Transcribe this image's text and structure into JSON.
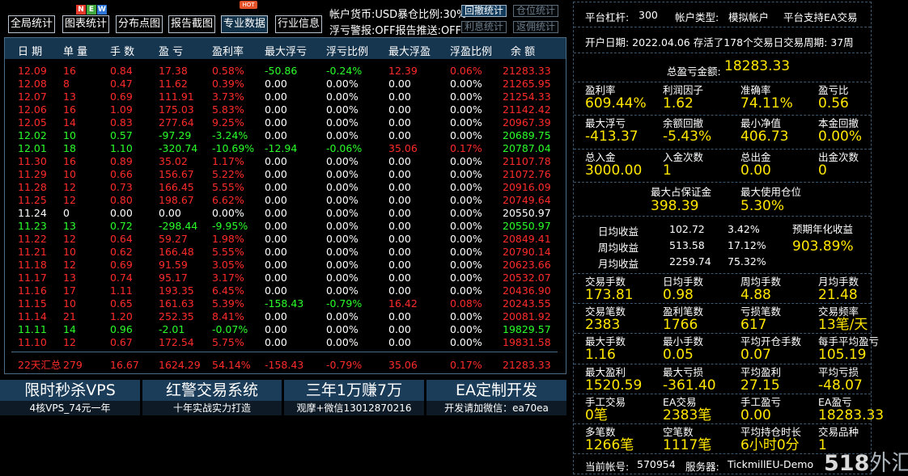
{
  "toolbar": {
    "buttons": [
      "全局统计",
      "图表统计",
      "分布点图",
      "报告截图",
      "专业数据",
      "行业信息"
    ],
    "new_badge": [
      "N",
      "E",
      "W"
    ],
    "hot_badge": "HOT"
  },
  "settings": {
    "line1": "帐户货币:USD暴仓比例:30%",
    "line2": "浮亏警报:OFF报告推送:OFF",
    "btn_drawdown": "回撤统计",
    "btn_position": "仓位统计",
    "btn_interest": "利息统计",
    "btn_rebate": "返佣统计"
  },
  "table": {
    "headers": [
      "日 期",
      "单 量",
      "手 数",
      "盈 亏",
      "盈利率",
      "最大浮亏",
      "浮亏比例",
      "最大浮盈",
      "浮盈比例",
      "余 额"
    ],
    "rows": [
      [
        "12.09",
        "16",
        "0.84",
        "17.38",
        "0.58%",
        "-50.86",
        "-0.24%",
        "12.39",
        "0.06%",
        "21283.33"
      ],
      [
        "12.08",
        "8",
        "0.47",
        "11.62",
        "0.39%",
        "0.00",
        "0.00%",
        "0.00",
        "0.00%",
        "21265.95"
      ],
      [
        "12.07",
        "13",
        "0.69",
        "111.91",
        "3.73%",
        "0.00",
        "0.00%",
        "0.00",
        "0.00%",
        "21254.33"
      ],
      [
        "12.06",
        "16",
        "1.09",
        "175.03",
        "5.83%",
        "0.00",
        "0.00%",
        "0.00",
        "0.00%",
        "21142.42"
      ],
      [
        "12.05",
        "14",
        "0.83",
        "277.64",
        "9.25%",
        "0.00",
        "0.00%",
        "0.00",
        "0.00%",
        "20967.39"
      ],
      [
        "12.02",
        "10",
        "0.57",
        "-97.29",
        "-3.24%",
        "0.00",
        "0.00%",
        "0.00",
        "0.00%",
        "20689.75"
      ],
      [
        "12.01",
        "18",
        "1.10",
        "-320.74",
        "-10.69%",
        "-12.94",
        "-0.06%",
        "35.06",
        "0.17%",
        "20787.04"
      ],
      [
        "11.30",
        "16",
        "0.89",
        "35.02",
        "1.17%",
        "0.00",
        "0.00%",
        "0.00",
        "0.00%",
        "21107.78"
      ],
      [
        "11.29",
        "10",
        "0.66",
        "156.67",
        "5.22%",
        "0.00",
        "0.00%",
        "0.00",
        "0.00%",
        "21072.76"
      ],
      [
        "11.28",
        "12",
        "0.73",
        "166.45",
        "5.55%",
        "0.00",
        "0.00%",
        "0.00",
        "0.00%",
        "20916.09"
      ],
      [
        "11.25",
        "12",
        "0.80",
        "198.67",
        "6.62%",
        "0.00",
        "0.00%",
        "0.00",
        "0.00%",
        "20749.64"
      ],
      [
        "11.24",
        "0",
        "0.00",
        "0.00",
        "0.00%",
        "0.00",
        "0.00%",
        "0.00",
        "0.00%",
        "20550.97"
      ],
      [
        "11.23",
        "13",
        "0.72",
        "-298.44",
        "-9.95%",
        "0.00",
        "0.00%",
        "0.00",
        "0.00%",
        "20550.97"
      ],
      [
        "11.22",
        "12",
        "0.64",
        "59.27",
        "1.98%",
        "0.00",
        "0.00%",
        "0.00",
        "0.00%",
        "20849.41"
      ],
      [
        "11.21",
        "10",
        "0.62",
        "166.48",
        "5.55%",
        "0.00",
        "0.00%",
        "0.00",
        "0.00%",
        "20790.14"
      ],
      [
        "11.18",
        "12",
        "0.69",
        "91.59",
        "3.05%",
        "0.00",
        "0.00%",
        "0.00",
        "0.00%",
        "20623.66"
      ],
      [
        "11.17",
        "13",
        "0.74",
        "95.17",
        "3.17%",
        "0.00",
        "0.00%",
        "0.00",
        "0.00%",
        "20532.07"
      ],
      [
        "11.16",
        "17",
        "1.11",
        "193.35",
        "6.45%",
        "0.00",
        "0.00%",
        "0.00",
        "0.00%",
        "20436.90"
      ],
      [
        "11.15",
        "10",
        "0.65",
        "161.63",
        "5.39%",
        "-158.43",
        "-0.79%",
        "16.42",
        "0.08%",
        "20243.55"
      ],
      [
        "11.14",
        "21",
        "1.20",
        "252.35",
        "8.41%",
        "0.00",
        "0.00%",
        "0.00",
        "0.00%",
        "20081.92"
      ],
      [
        "11.11",
        "14",
        "0.96",
        "-2.01",
        "-0.07%",
        "0.00",
        "0.00%",
        "0.00",
        "0.00%",
        "19829.57"
      ],
      [
        "11.10",
        "12",
        "0.67",
        "172.54",
        "5.75%",
        "0.00",
        "0.00%",
        "0.00",
        "0.00%",
        "19831.58"
      ]
    ],
    "summary": [
      "22天汇总",
      "279",
      "16.67",
      "1624.29",
      "54.14%",
      "-158.43",
      "-0.79%",
      "35.06",
      "0.17%",
      "21283.33"
    ]
  },
  "promos": [
    {
      "title": "限时秒杀VPS",
      "sub": "4核VPS_74元一年"
    },
    {
      "title": "红警交易系统",
      "sub": "十年实战实力打造"
    },
    {
      "title": "三年1万赚7万",
      "sub": "观摩+微信13012870216"
    },
    {
      "title": "EA定制开发",
      "sub": "开发请加微信：ea70ea"
    }
  ],
  "panel": {
    "leverage_label": "平台杠杆:",
    "leverage": "300",
    "acct_type_label": "帐户类型:",
    "acct_type": "模拟帐户",
    "ea_support": "平台支持EA交易",
    "open_date": "开户日期: 2022.04.06 存活了178个交易日交易周期: 37周",
    "total_pl_label": "总盈亏金额:",
    "total_pl": "18283.33",
    "grid_a": [
      {
        "label": "盈利率",
        "value": "609.44%"
      },
      {
        "label": "利润因子",
        "value": "1.62"
      },
      {
        "label": "准确率",
        "value": "74.11%"
      },
      {
        "label": "盈亏比",
        "value": "0.56"
      },
      {
        "label": "最大浮亏",
        "value": "-413.37"
      },
      {
        "label": "余额回撤",
        "value": "-5.43%"
      },
      {
        "label": "最小净值",
        "value": "406.73"
      },
      {
        "label": "本金回撤",
        "value": "0.00%"
      },
      {
        "label": "总入金",
        "value": "3000.00"
      },
      {
        "label": "入金次数",
        "value": "1"
      },
      {
        "label": "总出金",
        "value": "0.00"
      },
      {
        "label": "出金次数",
        "value": "0"
      }
    ],
    "margin_max_label": "最大占保证金",
    "margin_max": "398.39",
    "pos_max_label": "最大使用仓位",
    "pos_max": "5.30%",
    "returns": [
      {
        "label": "日均收益",
        "amount": "102.72",
        "pct": "3.42%"
      },
      {
        "label": "周均收益",
        "amount": "513.58",
        "pct": "17.12%"
      },
      {
        "label": "月均收益",
        "amount": "2259.74",
        "pct": "75.32%"
      }
    ],
    "annual_label": "预期年化收益",
    "annual": "903.89%",
    "grid_b": [
      {
        "label": "交易手数",
        "value": "173.81"
      },
      {
        "label": "日均手数",
        "value": "0.98"
      },
      {
        "label": "周均手数",
        "value": "4.88"
      },
      {
        "label": "月均手数",
        "value": "21.48"
      },
      {
        "label": "交易笔数",
        "value": "2383"
      },
      {
        "label": "盈利笔数",
        "value": "1766"
      },
      {
        "label": "亏损笔数",
        "value": "617"
      },
      {
        "label": "交易频率",
        "value": "13笔/天"
      },
      {
        "label": "最大手数",
        "value": "1.16"
      },
      {
        "label": "最小手数",
        "value": "0.05"
      },
      {
        "label": "平均开仓手数",
        "value": "0.07"
      },
      {
        "label": "每手平均盈亏",
        "value": "105.19"
      },
      {
        "label": "最大盈利",
        "value": "1520.59"
      },
      {
        "label": "最大亏损",
        "value": "-361.40"
      },
      {
        "label": "平均盈利",
        "value": "27.15"
      },
      {
        "label": "平均亏损",
        "value": "-48.07"
      },
      {
        "label": "手工交易",
        "value": "0笔"
      },
      {
        "label": "EA交易",
        "value": "2383笔"
      },
      {
        "label": "手工盈亏",
        "value": "0.00"
      },
      {
        "label": "EA盈亏",
        "value": "18283.33"
      },
      {
        "label": "多笔数",
        "value": "1266笔"
      },
      {
        "label": "空笔数",
        "value": "1117笔"
      },
      {
        "label": "平均持仓时长",
        "value": "6小时0分"
      },
      {
        "label": "交易品种",
        "value": "1"
      }
    ],
    "account_label": "当前帐号:",
    "account": "570954",
    "server_label": "服务器:",
    "server": "TickmillEU-Demo"
  },
  "watermark": {
    "num": "518",
    "text": "外汇网"
  },
  "colors": {
    "red": "#ff2b2b",
    "green": "#2bff2b",
    "yellow": "#ffe600",
    "header": "#16354f",
    "promo": "#1b3d59"
  }
}
